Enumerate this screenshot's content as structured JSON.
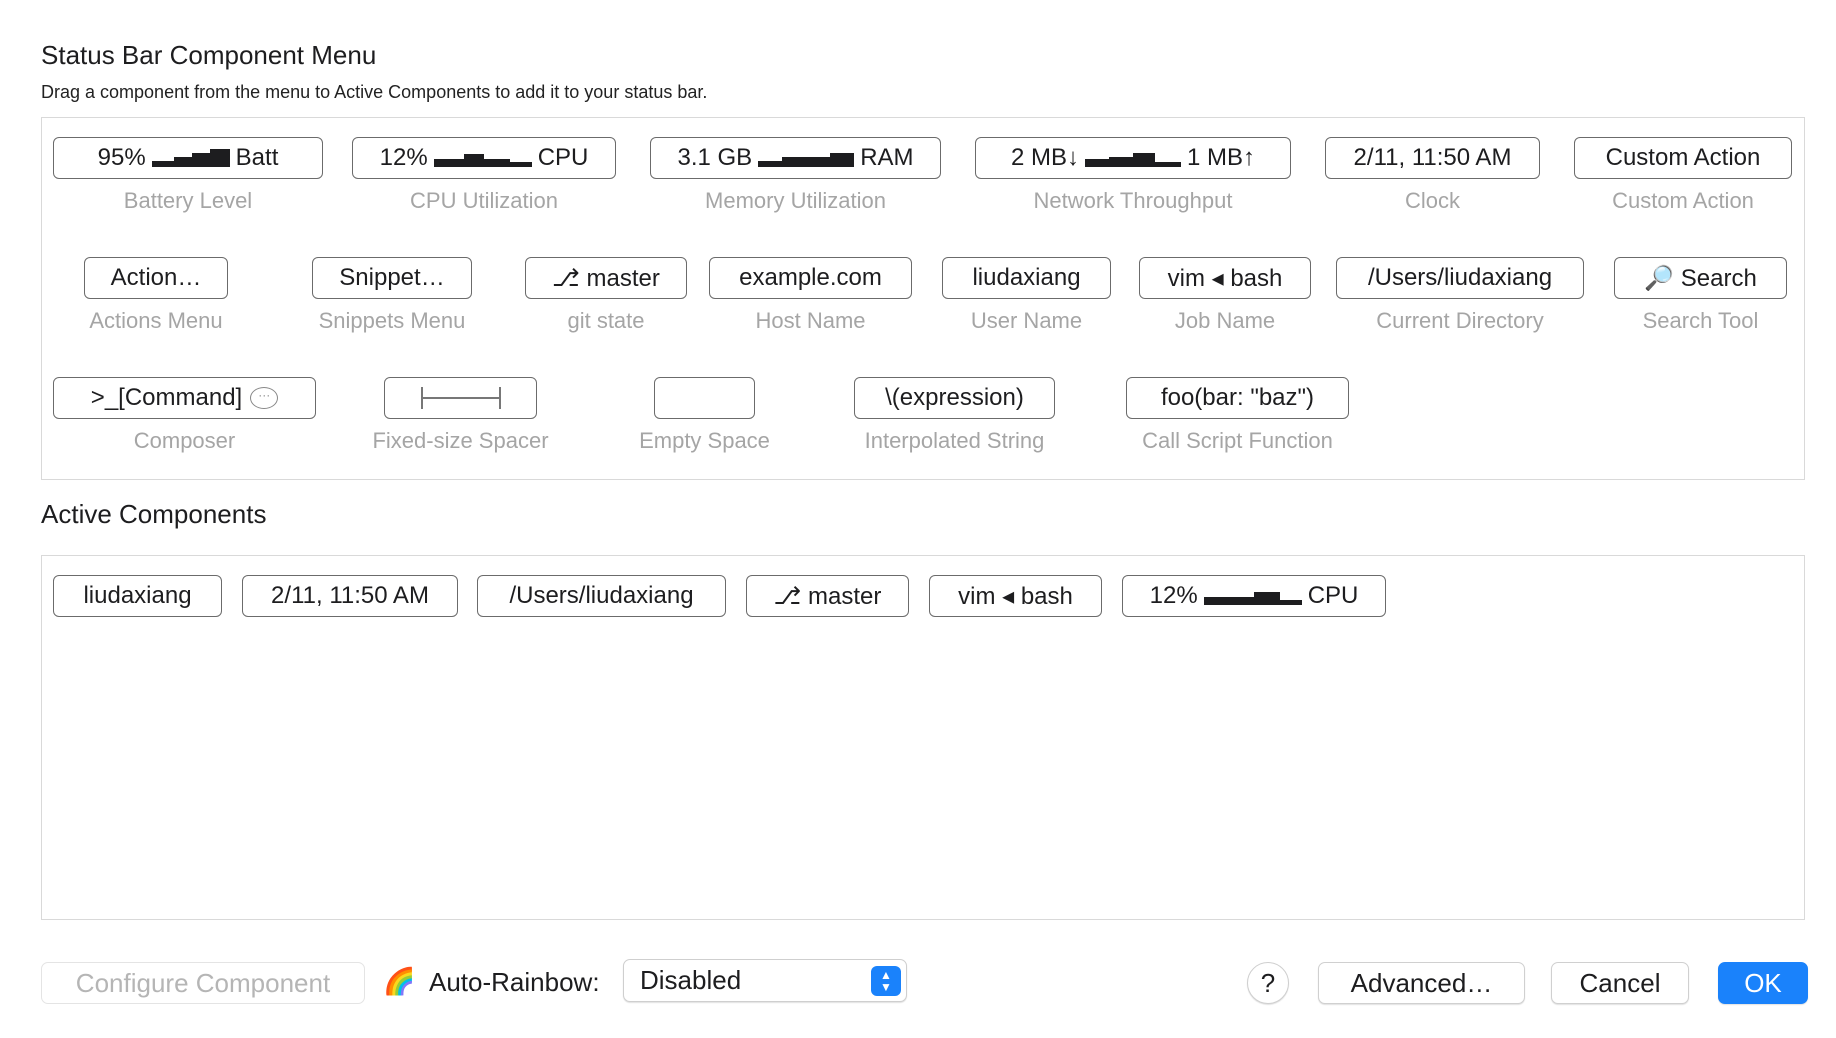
{
  "header": {
    "title": "Status Bar Component Menu",
    "subtitle": "Drag a component from the menu to Active Components to add it to your status bar."
  },
  "menu": {
    "components": [
      {
        "pill": "95%",
        "caption": "Battery Level",
        "suffix": "Batt"
      },
      {
        "pill": "12%",
        "caption": "CPU Utilization",
        "suffix": "CPU"
      },
      {
        "pill": "3.1 GB",
        "caption": "Memory Utilization",
        "suffix": "RAM"
      },
      {
        "pill": "2 MB↓",
        "caption": "Network Throughput",
        "suffix": "1 MB↑"
      },
      {
        "pill": "2/11, 11:50 AM",
        "caption": "Clock"
      },
      {
        "pill": "Custom Action",
        "caption": "Custom Action"
      },
      {
        "pill": "Action…",
        "caption": "Actions Menu"
      },
      {
        "pill": "Snippet…",
        "caption": "Snippets Menu"
      },
      {
        "pill": "⎇ master",
        "caption": "git state"
      },
      {
        "pill": "example.com",
        "caption": "Host Name"
      },
      {
        "pill": "liudaxiang",
        "caption": "User Name"
      },
      {
        "pill": "vim ◂ bash",
        "caption": "Job Name"
      },
      {
        "pill": "/Users/liudaxiang",
        "caption": "Current Directory"
      },
      {
        "pill": "🔎 Search",
        "caption": "Search Tool"
      },
      {
        "pill": ">_[Command]",
        "caption": "Composer"
      },
      {
        "pill": "",
        "caption": "Fixed-size Spacer"
      },
      {
        "pill": "",
        "caption": "Empty Space"
      },
      {
        "pill": "\\(expression)",
        "caption": "Interpolated String"
      },
      {
        "pill": "foo(bar: \"baz\")",
        "caption": "Call Script Function"
      }
    ]
  },
  "active": {
    "title": "Active Components",
    "items": [
      {
        "label": "liudaxiang"
      },
      {
        "label": "2/11, 11:50 AM"
      },
      {
        "label": "/Users/liudaxiang"
      },
      {
        "label": "⎇ master"
      },
      {
        "label": "vim ◂ bash"
      },
      {
        "label": "12%",
        "suffix": "CPU"
      }
    ]
  },
  "footer": {
    "configure_label": "Configure Component",
    "rainbow_emoji": "🌈",
    "auto_rainbow_label": "Auto-Rainbow:",
    "auto_rainbow_value": "Disabled",
    "help_label": "?",
    "advanced_label": "Advanced…",
    "cancel_label": "Cancel",
    "ok_label": "OK"
  },
  "colors": {
    "accent": "#1a82fb",
    "caption": "#a5a5a5",
    "pill_border": "#6b6b6b"
  }
}
